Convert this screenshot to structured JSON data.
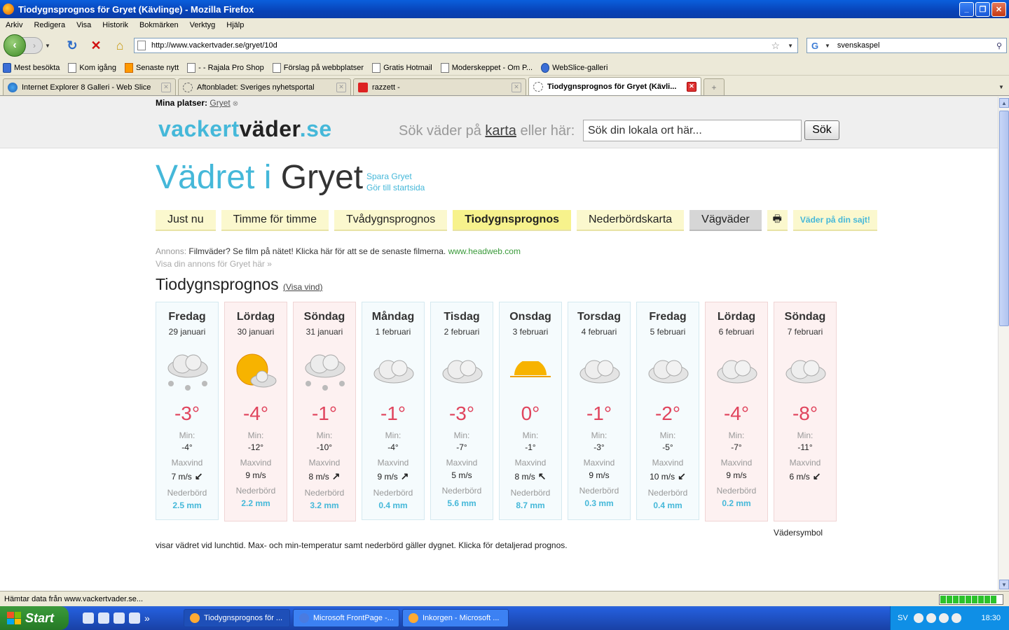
{
  "window": {
    "title": "Tiodygnsprognos för Gryet (Kävlinge) - Mozilla Firefox"
  },
  "menu": [
    "Arkiv",
    "Redigera",
    "Visa",
    "Historik",
    "Bokmärken",
    "Verktyg",
    "Hjälp"
  ],
  "nav": {
    "url": "http://www.vackertvader.se/gryet/10d",
    "search_value": "svenskaspel"
  },
  "bookmarks": [
    {
      "label": "Mest besökta",
      "icon": "blue"
    },
    {
      "label": "Kom igång",
      "icon": "page"
    },
    {
      "label": "Senaste nytt",
      "icon": "rss"
    },
    {
      "label": "- - Rajala Pro Shop",
      "icon": "page"
    },
    {
      "label": "Förslag på webbplatser",
      "icon": "page"
    },
    {
      "label": "Gratis Hotmail",
      "icon": "page"
    },
    {
      "label": "Moderskeppet - Om P...",
      "icon": "page"
    },
    {
      "label": "WebSlice-galleri",
      "icon": "ie"
    }
  ],
  "tabs": [
    {
      "label": "Internet Explorer 8 Galleri - Web Slice",
      "icon": "ie",
      "active": false
    },
    {
      "label": "Aftonbladet: Sveriges nyhetsportal",
      "icon": "loading",
      "active": false
    },
    {
      "label": "razzett -",
      "icon": "bk",
      "active": false
    },
    {
      "label": "Tiodygnsprognos för Gryet (Kävli...",
      "icon": "loading",
      "active": true
    }
  ],
  "site": {
    "myplaces_label": "Mina platser:",
    "myplaces_place": "Gryet",
    "logo": {
      "a": "vackert",
      "b": "väder",
      ".c": ".se"
    },
    "search_lead": "Sök väder på",
    "search_karta": "karta",
    "search_tail": "eller här:",
    "search_placeholder": "Sök din lokala ort här...",
    "search_button": "Sök",
    "heading_prefix": "Vädret i",
    "heading_place": "Gryet",
    "save_link": "Spara Gryet",
    "home_link": "Gör till startsida",
    "navtabs": [
      {
        "label": "Just nu",
        "style": "normal"
      },
      {
        "label": "Timme för timme",
        "style": "normal"
      },
      {
        "label": "Tvådygnsprognos",
        "style": "normal"
      },
      {
        "label": "Tiodygnsprognos",
        "style": "active"
      },
      {
        "label": "Nederbördskarta",
        "style": "normal"
      },
      {
        "label": "Vägväder",
        "style": "gray"
      }
    ],
    "sajt_label": "Väder på din sajt!",
    "annons_label": "Annons:",
    "annons_text": "Filmväder? Se film på nätet! Klicka här för att se de senaste filmerna.",
    "annons_url": "www.headweb.com",
    "annons2": "Visa din annons för Gryet här »",
    "section_title": "Tiodygnsprognos",
    "visa_vind": "Visa vind",
    "min_label": "Min:",
    "maxvind_label": "Maxvind",
    "nederbord_label": "Nederbörd",
    "days": [
      {
        "name": "Fredag",
        "date": "29 januari",
        "symbol": "snow",
        "max": "-3°",
        "min": "-4°",
        "wind": "7 m/s",
        "dir": "↙",
        "precip": "2.5 mm",
        "weekend": false
      },
      {
        "name": "Lördag",
        "date": "30 januari",
        "symbol": "sun-cloud",
        "max": "-4°",
        "min": "-12°",
        "wind": "9 m/s",
        "dir": "",
        "precip": "2.2 mm",
        "weekend": true
      },
      {
        "name": "Söndag",
        "date": "31 januari",
        "symbol": "snow",
        "max": "-1°",
        "min": "-10°",
        "wind": "8 m/s",
        "dir": "↗",
        "precip": "3.2 mm",
        "weekend": true
      },
      {
        "name": "Måndag",
        "date": "1 februari",
        "symbol": "cloud",
        "max": "-1°",
        "min": "-4°",
        "wind": "9 m/s",
        "dir": "↗",
        "precip": "0.4 mm",
        "weekend": false
      },
      {
        "name": "Tisdag",
        "date": "2 februari",
        "symbol": "cloud",
        "max": "-3°",
        "min": "-7°",
        "wind": "5 m/s",
        "dir": "",
        "precip": "5.6 mm",
        "weekend": false
      },
      {
        "name": "Onsdag",
        "date": "3 februari",
        "symbol": "halfsun",
        "max": "0°",
        "min": "-1°",
        "wind": "8 m/s",
        "dir": "↖",
        "precip": "8.7 mm",
        "weekend": false
      },
      {
        "name": "Torsdag",
        "date": "4 februari",
        "symbol": "cloud",
        "max": "-1°",
        "min": "-3°",
        "wind": "9 m/s",
        "dir": "",
        "precip": "0.3 mm",
        "weekend": false
      },
      {
        "name": "Fredag",
        "date": "5 februari",
        "symbol": "cloud",
        "max": "-2°",
        "min": "-5°",
        "wind": "10 m/s",
        "dir": "↙",
        "precip": "0.4 mm",
        "weekend": false
      },
      {
        "name": "Lördag",
        "date": "6 februari",
        "symbol": "cloud",
        "max": "-4°",
        "min": "-7°",
        "wind": "9 m/s",
        "dir": "",
        "precip": "0.2 mm",
        "weekend": true
      },
      {
        "name": "Söndag",
        "date": "7 februari",
        "symbol": "cloud",
        "max": "-8°",
        "min": "-11°",
        "wind": "6 m/s",
        "dir": "↙",
        "precip": "",
        "weekend": true
      }
    ],
    "vadersymbol": "Vädersymbol",
    "footnote": "visar vädret vid lunchtid. Max- och min-temperatur samt nederbörd gäller dygnet. Klicka för detaljerad prognos."
  },
  "status": {
    "text": "Hämtar data från www.vackertvader.se..."
  },
  "taskbar": {
    "start": "Start",
    "items": [
      "Tiodygnsprognos för ...",
      "Microsoft FrontPage -...",
      "Inkorgen - Microsoft ..."
    ],
    "lang": "SV",
    "clock": "18:30"
  }
}
